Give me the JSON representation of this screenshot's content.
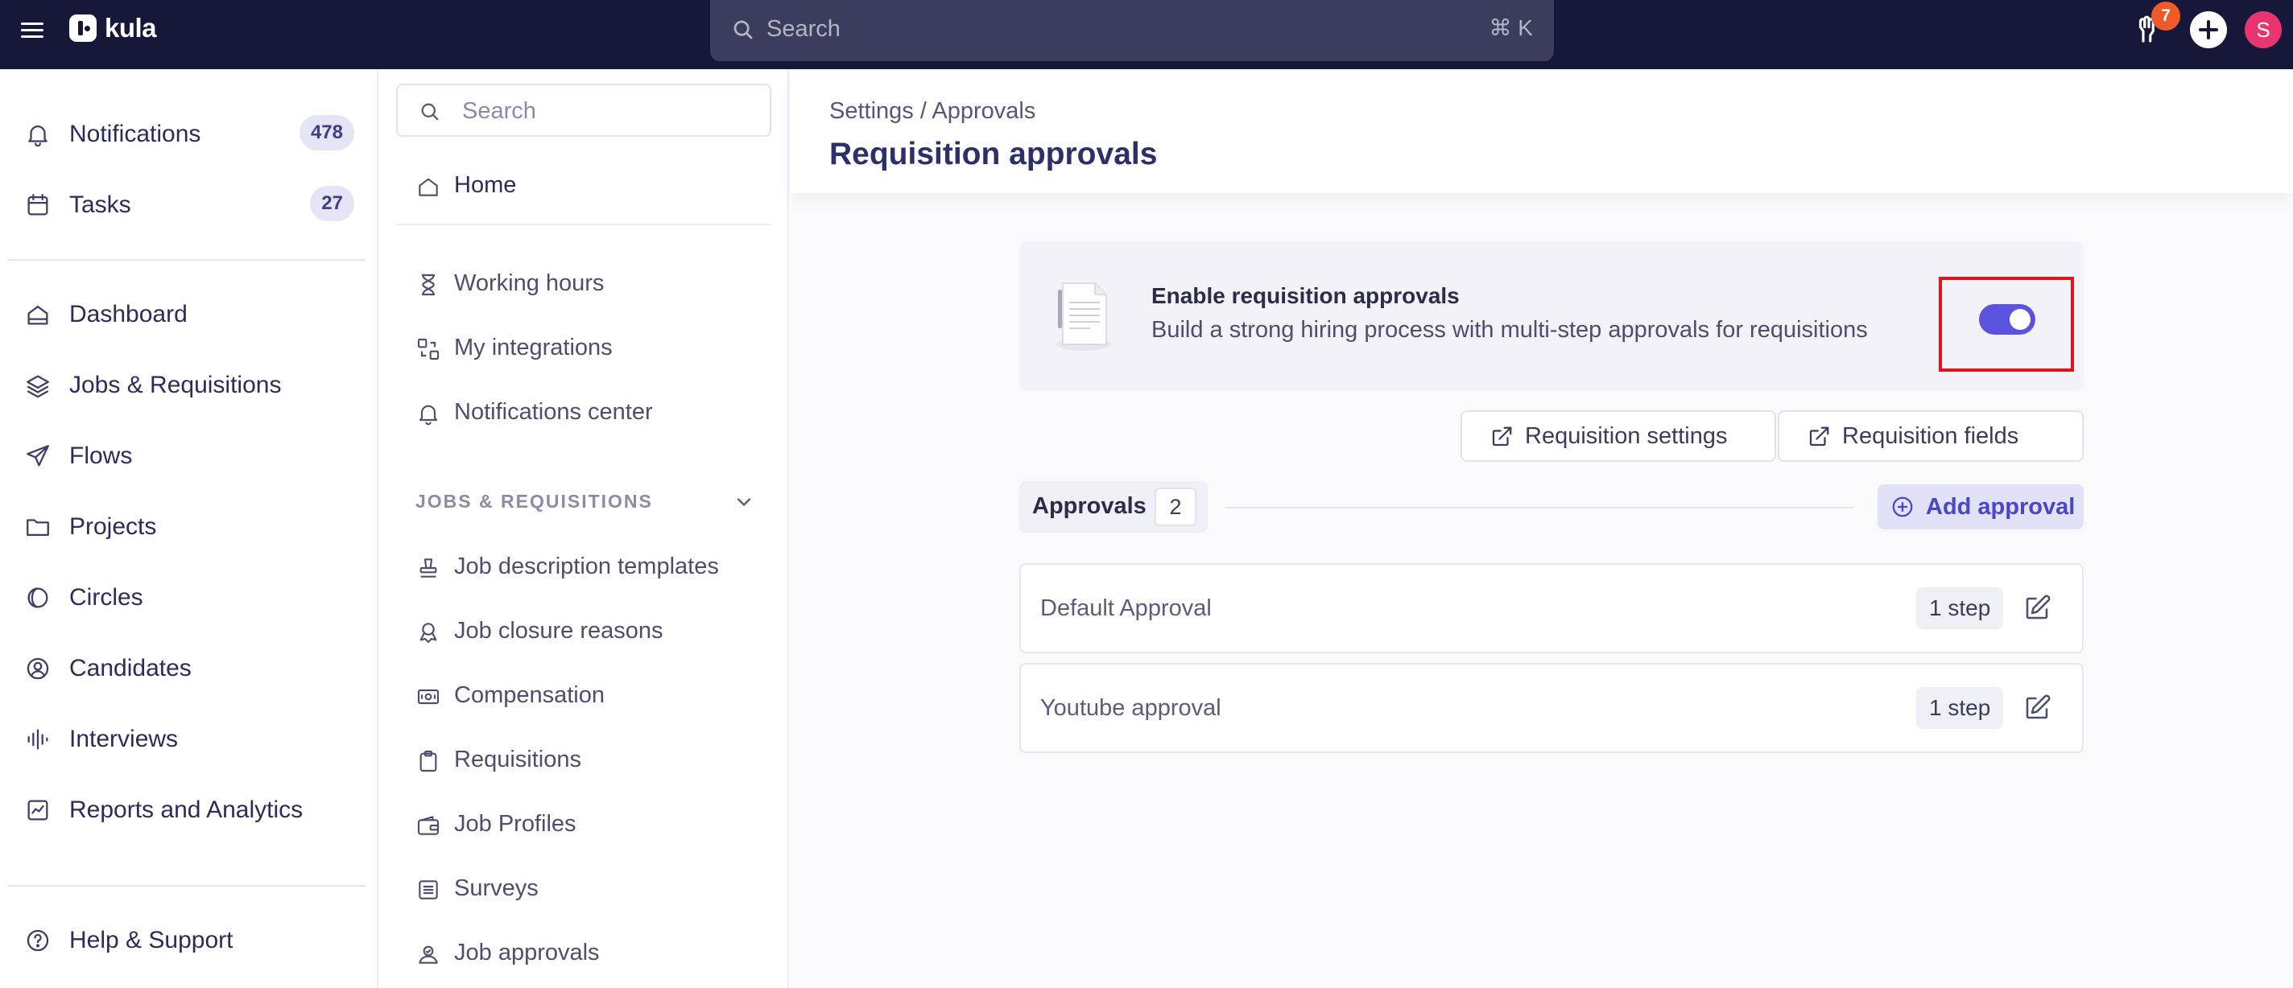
{
  "topbar": {
    "brand": "kula",
    "search_placeholder": "Search",
    "search_shortcut": "⌘ K",
    "help_badge": "7",
    "avatar_initial": "S"
  },
  "leftnav": {
    "items": [
      {
        "label": "Notifications",
        "count": "478",
        "icon": "bell-icon"
      },
      {
        "label": "Tasks",
        "count": "27",
        "icon": "calendar-icon"
      },
      {
        "label": "Dashboard",
        "icon": "home-icon"
      },
      {
        "label": "Jobs & Requisitions",
        "icon": "layers-icon"
      },
      {
        "label": "Flows",
        "icon": "send-icon"
      },
      {
        "label": "Projects",
        "icon": "folder-icon"
      },
      {
        "label": "Circles",
        "icon": "circles-icon"
      },
      {
        "label": "Candidates",
        "icon": "user-circle-icon"
      },
      {
        "label": "Interviews",
        "icon": "audio-bars-icon"
      },
      {
        "label": "Reports and Analytics",
        "icon": "chart-icon"
      },
      {
        "label": "Help & Support",
        "icon": "help-circle-icon"
      }
    ]
  },
  "subnav": {
    "search_placeholder": "Search",
    "home": "Home",
    "items": [
      {
        "label": "Working hours",
        "icon": "hourglass-icon"
      },
      {
        "label": "My integrations",
        "icon": "integrations-icon"
      },
      {
        "label": "Notifications center",
        "icon": "bell-icon"
      }
    ],
    "section_title": "JOBS & REQUISITIONS",
    "section_items": [
      {
        "label": "Job description templates",
        "icon": "stamp-icon"
      },
      {
        "label": "Job closure reasons",
        "icon": "badge-icon"
      },
      {
        "label": "Compensation",
        "icon": "money-icon"
      },
      {
        "label": "Requisitions",
        "icon": "clipboard-icon"
      },
      {
        "label": "Job Profiles",
        "icon": "wallet-icon"
      },
      {
        "label": "Surveys",
        "icon": "list-icon"
      },
      {
        "label": "Job approvals",
        "icon": "approval-icon"
      }
    ]
  },
  "main": {
    "breadcrumb": "Settings / Approvals",
    "title": "Requisition approvals",
    "enable": {
      "title": "Enable requisition approvals",
      "subtitle": "Build a strong hiring process with multi-step approvals for requisitions",
      "enabled": true
    },
    "buttons": {
      "requisition_settings": "Requisition settings",
      "requisition_fields": "Requisition fields",
      "add_approval": "Add approval"
    },
    "approvals_tab": {
      "label": "Approvals",
      "count": "2"
    },
    "approvals": [
      {
        "name": "Default Approval",
        "steps": "1 step"
      },
      {
        "name": "Youtube approval",
        "steps": "1 step"
      }
    ]
  }
}
